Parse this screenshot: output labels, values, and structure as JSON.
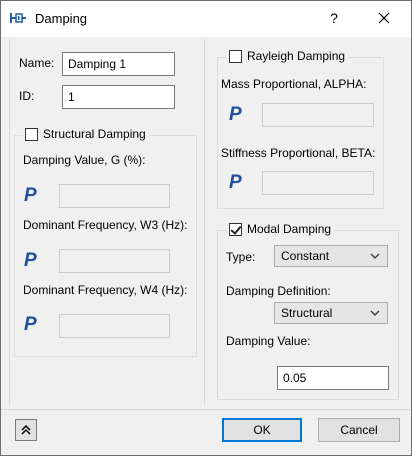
{
  "window": {
    "title": "Damping",
    "help": "?"
  },
  "fields": {
    "name_label": "Name:",
    "name_value": "Damping 1",
    "id_label": "ID:",
    "id_value": "1"
  },
  "structural": {
    "title": "Structural Damping",
    "checked": false,
    "damping_value_label": "Damping Value, G (%):",
    "w3_label": "Dominant Frequency, W3 (Hz):",
    "w4_label": "Dominant Frequency, W4 (Hz):",
    "param_icon": "P"
  },
  "rayleigh": {
    "title": "Rayleigh Damping",
    "checked": false,
    "mass_label": "Mass Proportional, ALPHA:",
    "stiffness_label": "Stiffness Proportional, BETA:",
    "param_icon": "P"
  },
  "modal": {
    "title": "Modal Damping",
    "checked": true,
    "type_label": "Type:",
    "type_value": "Constant",
    "definition_label": "Damping Definition:",
    "definition_value": "Structural",
    "value_label": "Damping Value:",
    "value_value": "0.05"
  },
  "footer": {
    "ok": "OK",
    "cancel": "Cancel"
  },
  "icons": {
    "title_icon": "damper-icon",
    "close": "close-icon",
    "expand": "chevron-double-up-icon",
    "param": "parameter-p-icon",
    "dropdown": "chevron-down-icon"
  },
  "colors": {
    "accent": "#0078d7",
    "param_blue": "#1f4e9c"
  }
}
